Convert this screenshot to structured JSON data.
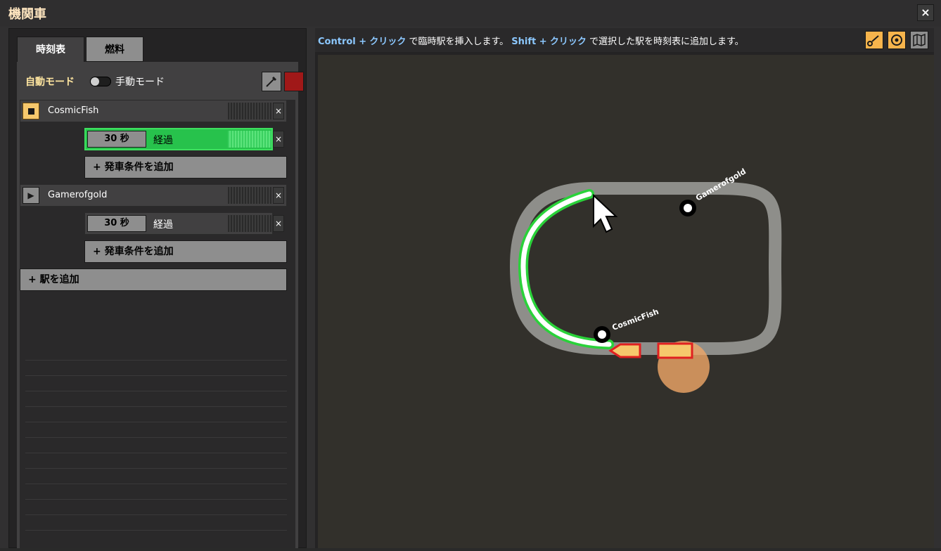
{
  "window": {
    "title": "機関車",
    "close": "×"
  },
  "tabs": [
    {
      "label": "時刻表"
    },
    {
      "label": "燃料"
    }
  ],
  "mode": {
    "auto_label": "自動モード",
    "manual_label": "手動モード"
  },
  "colors": {
    "accent_orange": "#f6c86c",
    "active_green": "#27c24c",
    "train_red": "#e02020"
  },
  "schedule": [
    {
      "name": "CosmicFish",
      "conditions": [
        {
          "time": "30 秒",
          "type": "経過"
        }
      ],
      "add_condition": "+ 発車条件を追加"
    },
    {
      "name": "Gamerofgold",
      "conditions": [
        {
          "time": "30 秒",
          "type": "経過"
        }
      ],
      "add_condition": "+ 発車条件を追加"
    }
  ],
  "add_station": "+ 駅を追加",
  "remove_icon": "×",
  "play_icon": "▶",
  "hint": {
    "ctrl_key": "Control +",
    "ctrl_click": "クリック",
    "ctrl_text": " で臨時駅を挿入します。 ",
    "shift_key": "Shift +",
    "shift_click": "クリック",
    "shift_text": " で選択した駅を時刻表に追加します。"
  },
  "map_labels": {
    "station_a": "Gamerofgold",
    "station_b": "CosmicFish"
  }
}
